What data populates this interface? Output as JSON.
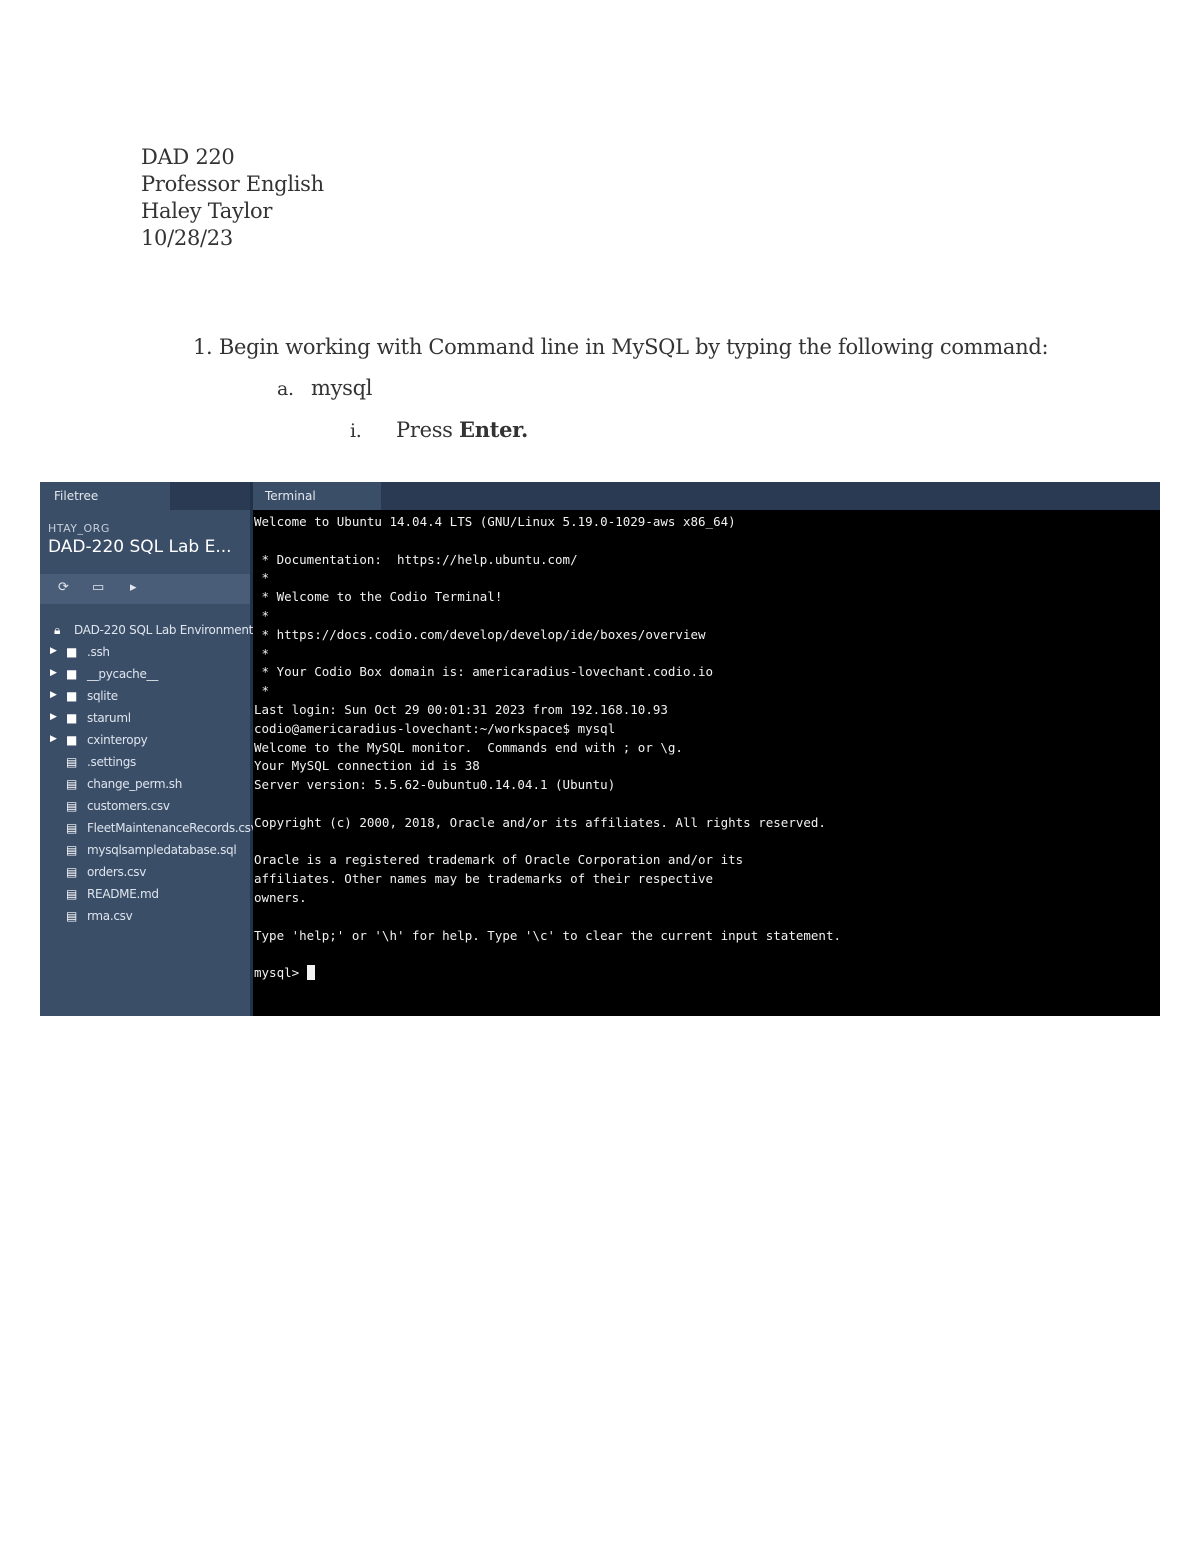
{
  "header": {
    "course": "DAD 220",
    "professor": "Professor English",
    "student": "Haley Taylor",
    "date": "10/28/23"
  },
  "steps": {
    "step1_marker": "1.",
    "step1_text": "Begin working with Command line in MySQL by typing the following command:",
    "step_a_marker": "a.",
    "step_a_text": "mysql",
    "step_i_marker": "i.",
    "step_i_text": "Press",
    "step_i_bold": "Enter."
  },
  "ide": {
    "filetree": {
      "tab_label": "Filetree",
      "org": "HTAY_ORG",
      "project": "DAD-220 SQL Lab E...",
      "root": "DAD-220 SQL Lab Environment",
      "folders": [
        ".ssh",
        "__pycache__",
        "sqlite",
        "staruml",
        "cxinteropy"
      ],
      "files": [
        ".settings",
        "change_perm.sh",
        "customers.csv",
        "FleetMaintenanceRecords.csv",
        "mysqlsampledatabase.sql",
        "orders.csv",
        "README.md",
        "rma.csv"
      ],
      "icons": {
        "lock": "lock-icon",
        "folder": "folder-icon",
        "file": "file-icon",
        "refresh": "refresh-icon",
        "terminal": "terminal-icon",
        "play": "play-icon"
      }
    },
    "terminal": {
      "tab_label": "Terminal",
      "lines": [
        "Welcome to Ubuntu 14.04.4 LTS (GNU/Linux 5.19.0-1029-aws x86_64)",
        "",
        " * Documentation:  https://help.ubuntu.com/",
        " *",
        " * Welcome to the Codio Terminal!",
        " *",
        " * https://docs.codio.com/develop/develop/ide/boxes/overview",
        " *",
        " * Your Codio Box domain is: americaradius-lovechant.codio.io",
        " *",
        "Last login: Sun Oct 29 00:01:31 2023 from 192.168.10.93",
        "codio@americaradius-lovechant:~/workspace$ mysql",
        "Welcome to the MySQL monitor.  Commands end with ; or \\g.",
        "Your MySQL connection id is 38",
        "Server version: 5.5.62-0ubuntu0.14.04.1 (Ubuntu)",
        "",
        "Copyright (c) 2000, 2018, Oracle and/or its affiliates. All rights reserved.",
        "",
        "Oracle is a registered trademark of Oracle Corporation and/or its",
        "affiliates. Other names may be trademarks of their respective",
        "owners.",
        "",
        "Type 'help;' or '\\h' for help. Type '\\c' to clear the current input statement.",
        ""
      ],
      "prompt": "mysql> "
    }
  }
}
